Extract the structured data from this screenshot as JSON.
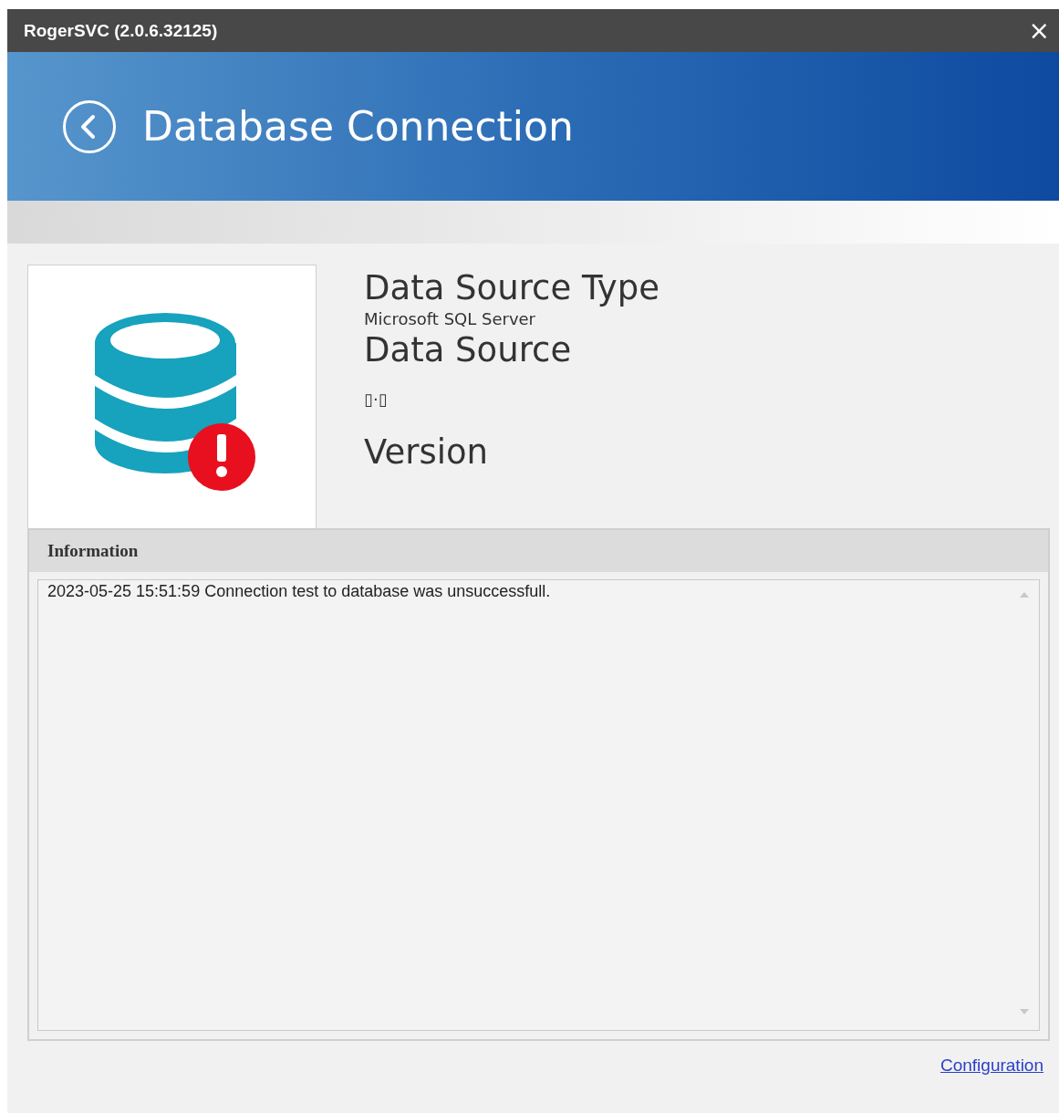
{
  "window": {
    "title": "RogerSVC (2.0.6.32125)",
    "close": "×"
  },
  "header": {
    "title": "Database Connection"
  },
  "details": [
    {
      "kind": "heading",
      "text": "Data Source Type"
    },
    {
      "kind": "value",
      "text": "Microsoft SQL Server"
    },
    {
      "kind": "heading",
      "text": "Data Source"
    },
    {
      "kind": "value",
      "text": "▯·▯"
    },
    {
      "kind": "heading",
      "text": "Version"
    }
  ],
  "status_icon": {
    "error": true
  },
  "information": {
    "title": "Information",
    "log": "2023-05-25 15:51:59 Connection test to database was unsuccessfull."
  },
  "footer": {
    "link": "Configuration"
  }
}
